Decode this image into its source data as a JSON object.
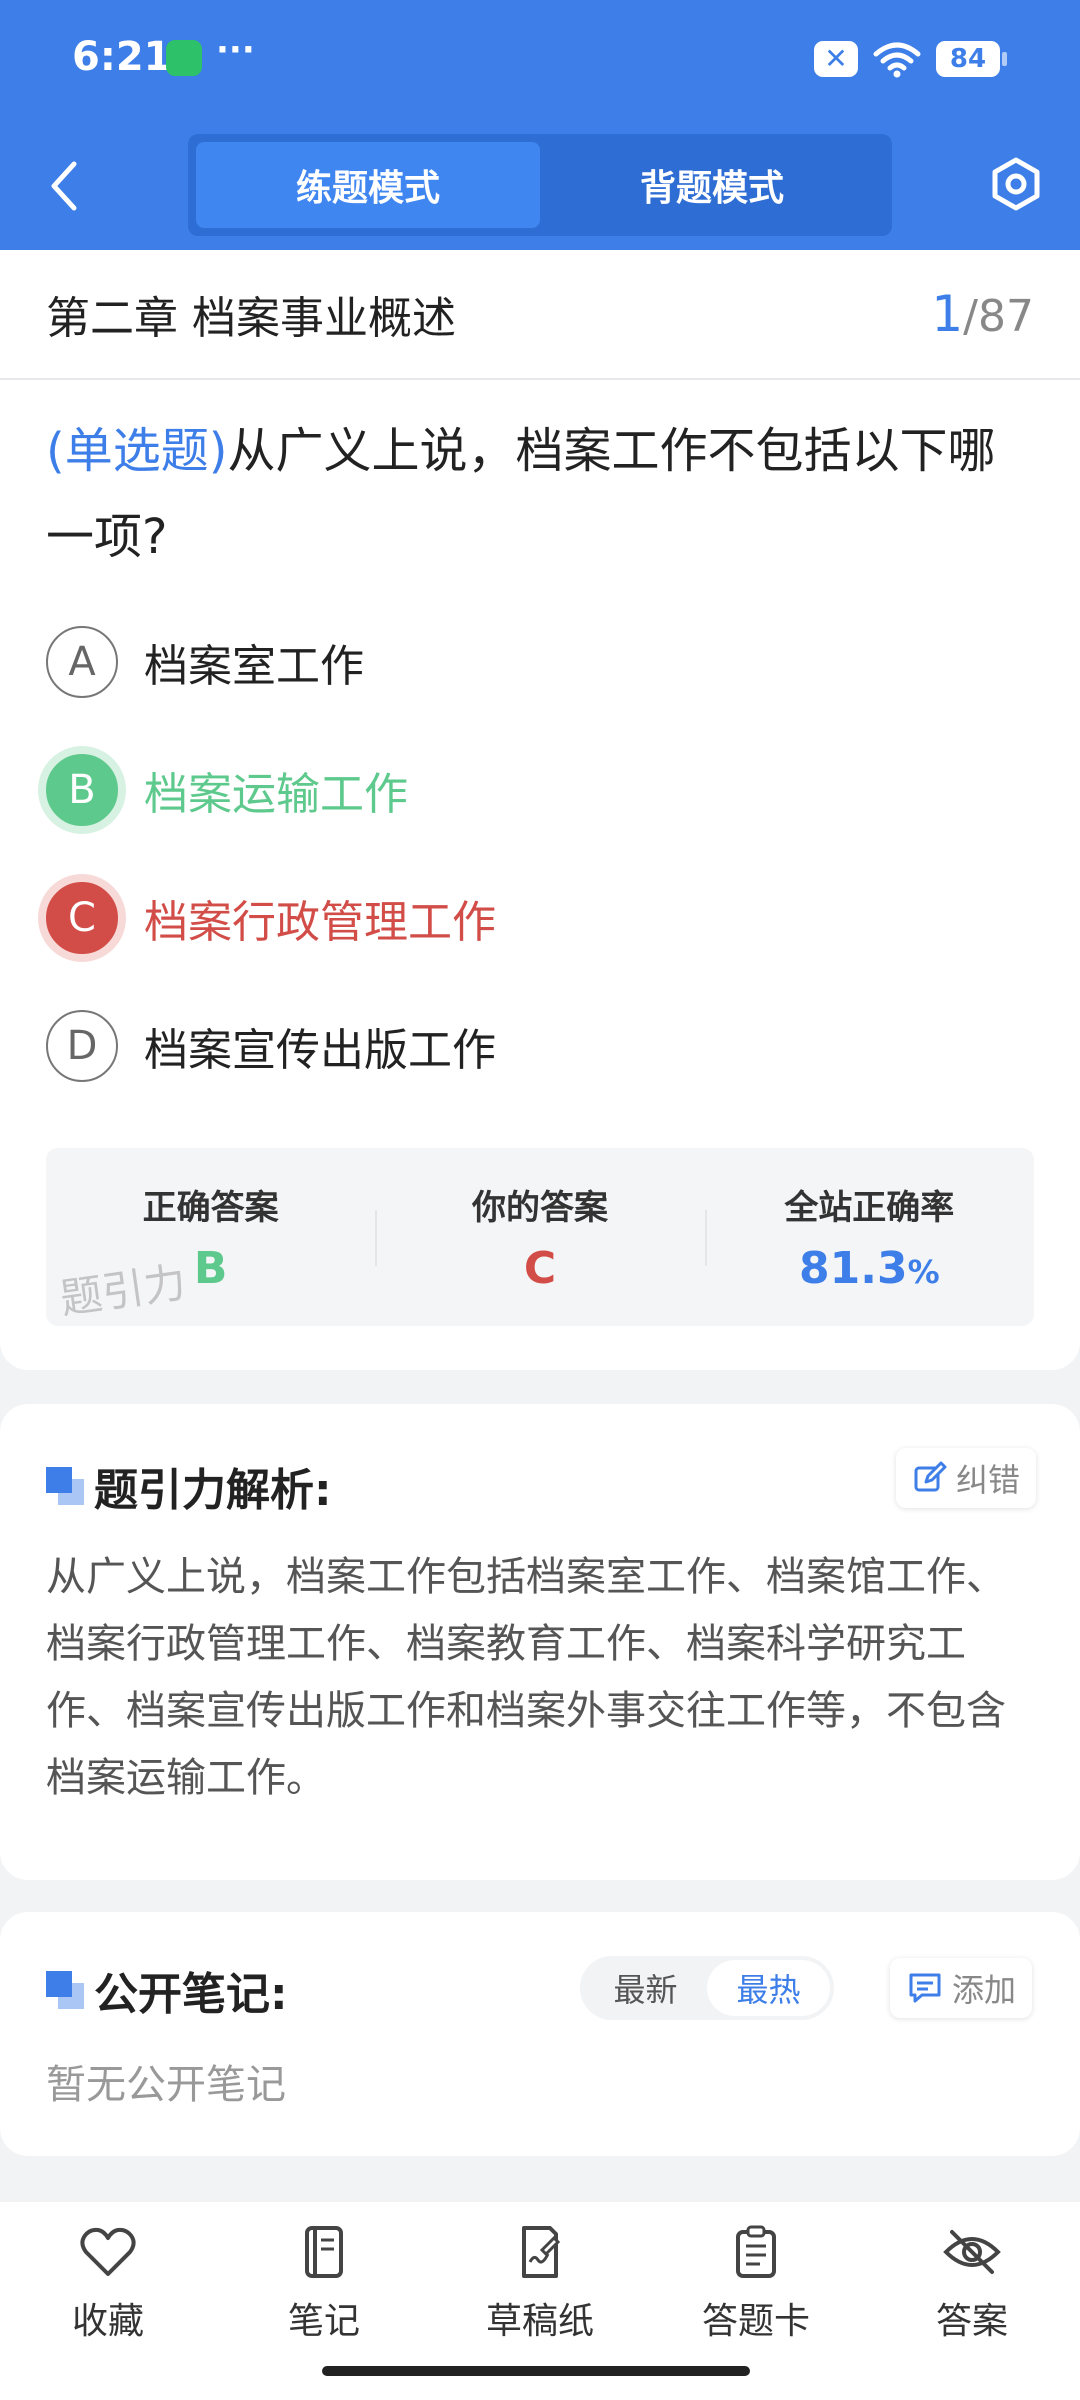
{
  "status_bar": {
    "time": "6:21",
    "dots": "···",
    "x_badge": "✕",
    "battery": "84"
  },
  "header": {
    "tabs": [
      {
        "label": "练题模式",
        "active": true
      },
      {
        "label": "背题模式",
        "active": false
      }
    ]
  },
  "question": {
    "chapter": "第二章 档案事业概述",
    "current": "1",
    "separator": "/",
    "total": "87",
    "type": "(单选题)",
    "text": "从广义上说，档案工作不包括以下哪一项?",
    "options": [
      {
        "letter": "A",
        "text": "档案室工作",
        "state": "normal"
      },
      {
        "letter": "B",
        "text": "档案运输工作",
        "state": "correct"
      },
      {
        "letter": "C",
        "text": "档案行政管理工作",
        "state": "wrong"
      },
      {
        "letter": "D",
        "text": "档案宣传出版工作",
        "state": "normal"
      }
    ]
  },
  "answer_summary": {
    "correct_label": "正确答案",
    "correct_value": "B",
    "yours_label": "你的答案",
    "yours_value": "C",
    "rate_label": "全站正确率",
    "rate_value": "81.3",
    "rate_unit": "%",
    "watermark": "题引力"
  },
  "analysis": {
    "title": "题引力解析:",
    "correct_button": "纠错",
    "text": "从广义上说，档案工作包括档案室工作、档案馆工作、档案行政管理工作、档案教育工作、档案科学研究工作、档案宣传出版工作和档案外事交往工作等，不包含档案运输工作。"
  },
  "notes": {
    "title": "公开笔记:",
    "sort_latest": "最新",
    "sort_hot": "最热",
    "add_button": "添加",
    "empty_text": "暂无公开笔记"
  },
  "bottom_nav": [
    {
      "label": "收藏",
      "icon": "heart-icon"
    },
    {
      "label": "笔记",
      "icon": "notebook-icon"
    },
    {
      "label": "草稿纸",
      "icon": "draft-paper-icon"
    },
    {
      "label": "答题卡",
      "icon": "answer-sheet-icon"
    },
    {
      "label": "答案",
      "icon": "eye-off-icon"
    }
  ],
  "colors": {
    "primary": "#3d7ee8",
    "correct": "#5ec98c",
    "wrong": "#d24d48"
  }
}
